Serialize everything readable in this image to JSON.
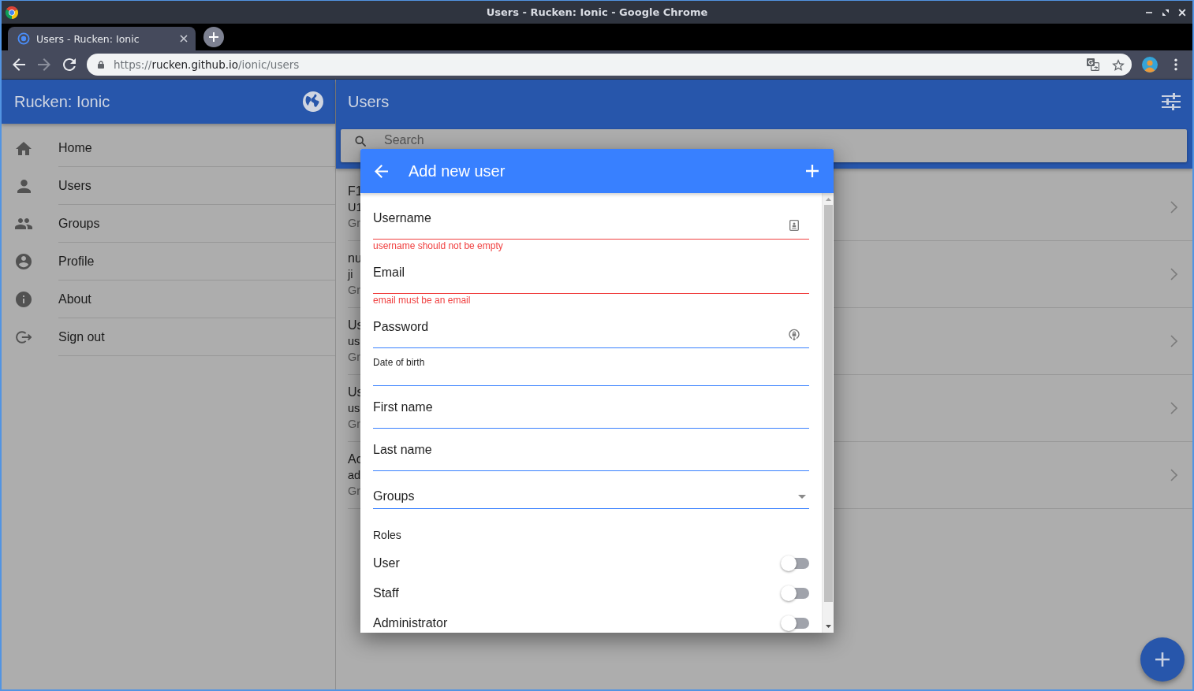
{
  "window": {
    "title": "Users - Rucken: Ionic - Google Chrome"
  },
  "browser": {
    "tabs": [
      {
        "title": "Users - Rucken: Ionic",
        "selected": true
      }
    ],
    "nav_buttons": [
      {
        "disabled": false
      },
      {
        "disabled": true
      },
      {
        "disabled": false
      }
    ],
    "url": {
      "scheme": "https://",
      "host": "rucken.github.io",
      "path": "/ionic/users"
    }
  },
  "sidebar": {
    "title": "Rucken: Ionic",
    "items": [
      {
        "label": "Home"
      },
      {
        "label": "Users"
      },
      {
        "label": "Groups"
      },
      {
        "label": "Profile"
      },
      {
        "label": "About"
      },
      {
        "label": "Sign out"
      }
    ]
  },
  "main": {
    "title": "Users",
    "search": {
      "placeholder": "Search"
    },
    "rows": [
      {
        "title": "F1",
        "subtitle": "U1",
        "detail": "Gr"
      },
      {
        "title": "nu",
        "subtitle": "ji",
        "detail": "Gr"
      },
      {
        "title": "Us",
        "subtitle": "us",
        "detail": "Gr"
      },
      {
        "title": "Us",
        "subtitle": "us",
        "detail": "Gr"
      },
      {
        "title": "Ac",
        "subtitle": "ad",
        "detail": "Gr"
      }
    ]
  },
  "modal": {
    "title": "Add new user",
    "fields": [
      {
        "kind": "username",
        "label": "Username",
        "error": "username should not be empty"
      },
      {
        "kind": "email",
        "label": "Email",
        "error": "email must be an email"
      },
      {
        "kind": "password",
        "label": "Password"
      },
      {
        "kind": "date",
        "label": "Date of birth"
      },
      {
        "kind": "text",
        "label": "First name"
      },
      {
        "kind": "text",
        "label": "Last name"
      },
      {
        "kind": "select",
        "label": "Groups"
      }
    ],
    "roles_label": "Roles",
    "roles": [
      {
        "label": "User",
        "on": false
      },
      {
        "label": "Staff",
        "on": false
      },
      {
        "label": "Administrator",
        "on": false
      }
    ]
  }
}
